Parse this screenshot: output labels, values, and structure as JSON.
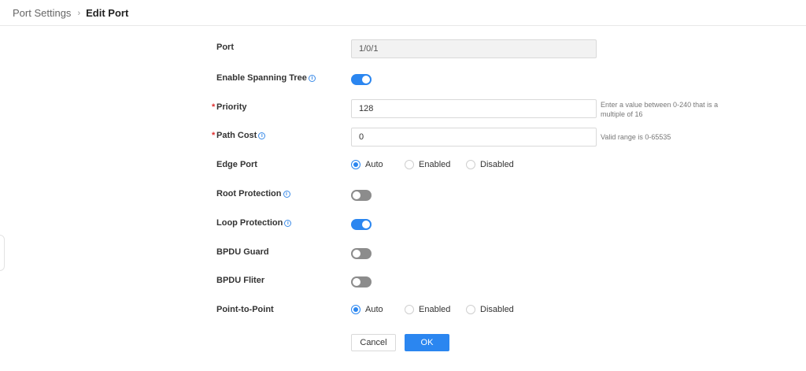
{
  "breadcrumb": {
    "parent": "Port Settings",
    "separator": "›",
    "current": "Edit Port"
  },
  "side_handle_icon": "chevron-icon",
  "form": {
    "port": {
      "label": "Port",
      "value": "1/0/1"
    },
    "spanning_tree": {
      "label": "Enable Spanning Tree",
      "enabled": true
    },
    "priority": {
      "label": "Priority",
      "required_mark": "*",
      "value": "128",
      "hint": "Enter a value between 0-240 that is a multiple of 16"
    },
    "path_cost": {
      "label": "Path Cost",
      "required_mark": "*",
      "value": "0",
      "hint": "Valid range is 0-65535"
    },
    "edge_port": {
      "label": "Edge Port",
      "options": [
        "Auto",
        "Enabled",
        "Disabled"
      ],
      "selected": "Auto"
    },
    "root_protection": {
      "label": "Root Protection",
      "enabled": false
    },
    "loop_protection": {
      "label": "Loop Protection",
      "enabled": true
    },
    "bpdu_guard": {
      "label": "BPDU Guard",
      "enabled": false
    },
    "bpdu_filter": {
      "label": "BPDU Fliter",
      "enabled": false
    },
    "point_to_point": {
      "label": "Point-to-Point",
      "options": [
        "Auto",
        "Enabled",
        "Disabled"
      ],
      "selected": "Auto"
    }
  },
  "info_icon_glyph": "i",
  "buttons": {
    "cancel": "Cancel",
    "ok": "OK"
  },
  "colors": {
    "accent": "#2b86f0",
    "toggle_off": "#8c8c8c",
    "required": "#e03030"
  }
}
